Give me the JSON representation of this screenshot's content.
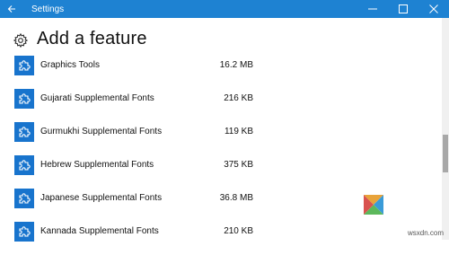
{
  "window": {
    "title": "Settings",
    "accent": "#1e82d2"
  },
  "page": {
    "title": "Add a feature",
    "icon": "gear-icon"
  },
  "features": [
    {
      "name": "Graphics Tools",
      "size": "16.2 MB",
      "icon": "puzzle-icon"
    },
    {
      "name": "Gujarati Supplemental Fonts",
      "size": "216 KB",
      "icon": "puzzle-icon"
    },
    {
      "name": "Gurmukhi Supplemental Fonts",
      "size": "119 KB",
      "icon": "puzzle-icon"
    },
    {
      "name": "Hebrew Supplemental Fonts",
      "size": "375 KB",
      "icon": "puzzle-icon"
    },
    {
      "name": "Japanese Supplemental Fonts",
      "size": "36.8 MB",
      "icon": "puzzle-icon"
    },
    {
      "name": "Kannada Supplemental Fonts",
      "size": "210 KB",
      "icon": "puzzle-icon"
    }
  ],
  "tile_color": "#1874cd",
  "watermark": "wsxdn.com"
}
